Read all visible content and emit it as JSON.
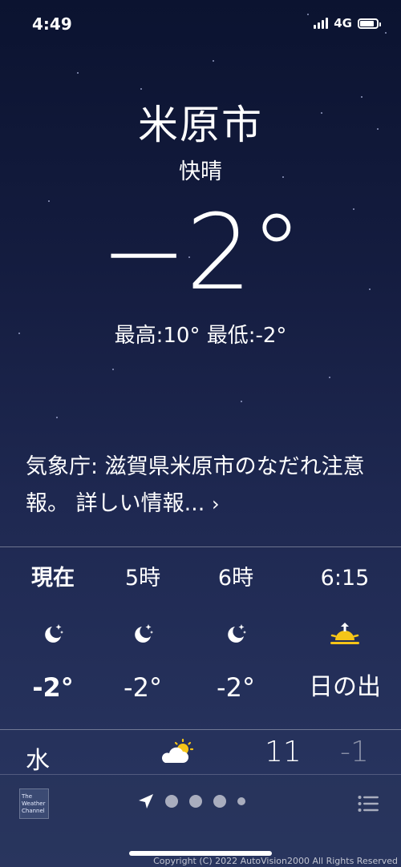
{
  "status_bar": {
    "time": "4:49",
    "network": "4G",
    "battery_level": 0.85
  },
  "location": {
    "city": "米原市",
    "condition": "快晴"
  },
  "current": {
    "temperature": "−2°",
    "hi_lo": "最高:10° 最低:-2°"
  },
  "alert": {
    "text": "気象庁: 滋賀県米原市のなだれ注意報。 詳しい情報...",
    "chevron": "›"
  },
  "hourly": [
    {
      "label": "現在",
      "icon": "moon-stars-icon",
      "temp": "-2°"
    },
    {
      "label": "5時",
      "icon": "moon-stars-icon",
      "temp": "-2°"
    },
    {
      "label": "6時",
      "icon": "moon-stars-icon",
      "temp": "-2°"
    },
    {
      "label": "6:15",
      "icon": "sunrise-icon",
      "temp": "日の出"
    }
  ],
  "daily": [
    {
      "day": "水",
      "icon": "partly-cloudy-icon",
      "high": "11",
      "low": "-1"
    }
  ],
  "footer": {
    "weather_channel": "The Weather Channel",
    "page_count": 4,
    "copyright": "Copyright (C) 2022 AutoVision2000 All Rights Reserved"
  },
  "colors": {
    "sun": "#f5c518",
    "background_top": "#0b1330",
    "background_bottom": "#2a3762"
  }
}
